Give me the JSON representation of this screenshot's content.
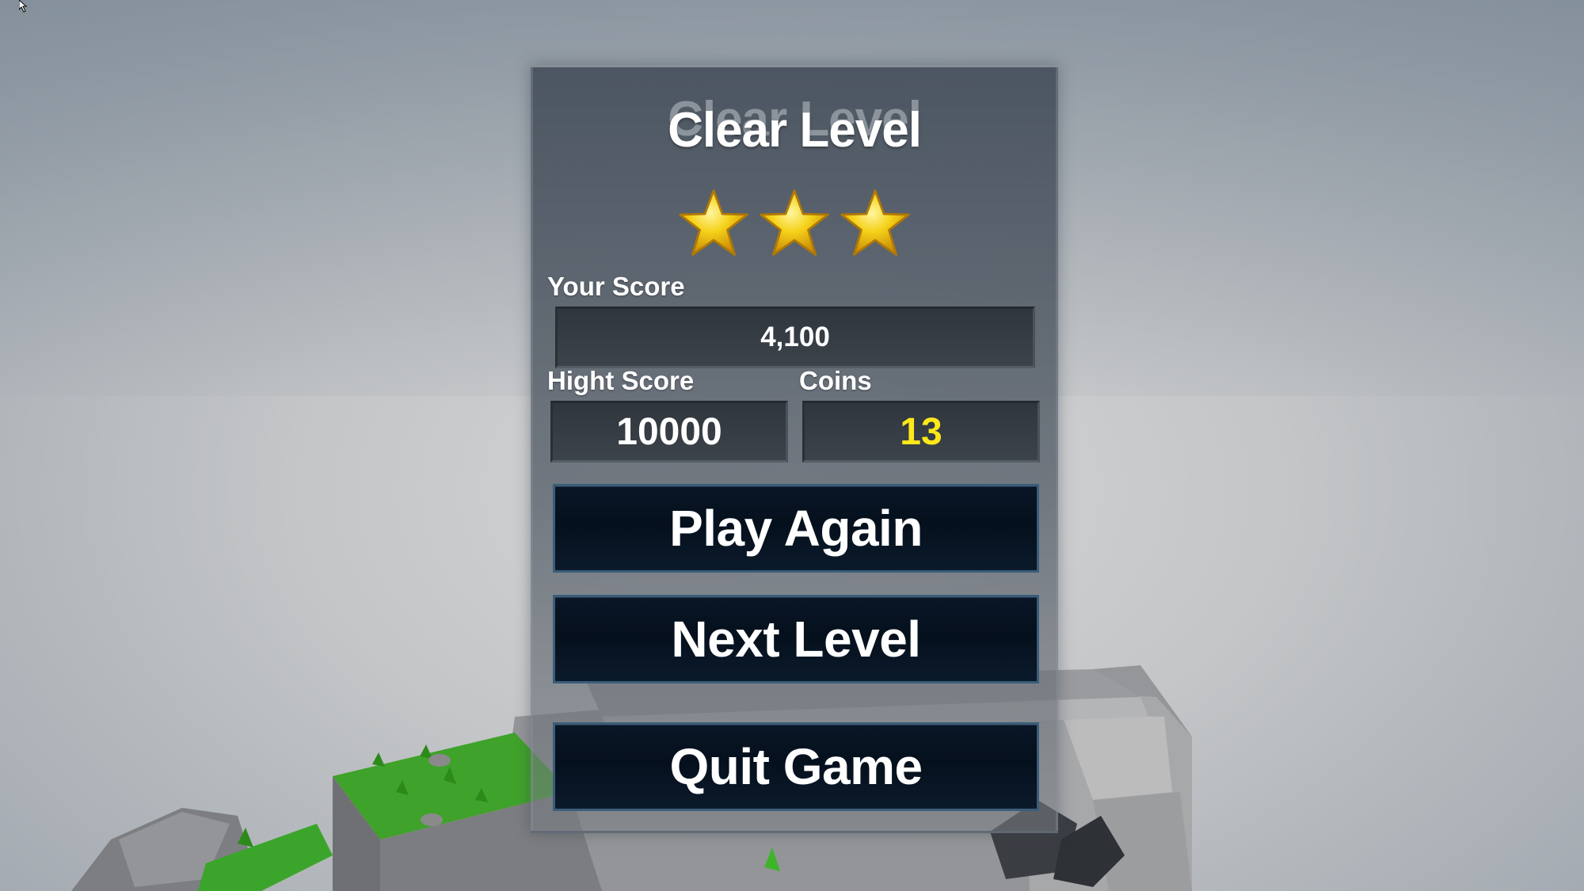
{
  "dialog": {
    "title": "Clear Level",
    "stars_earned": 3,
    "stars_total": 3,
    "star_color": "#f5d21a",
    "your_score_label": "Your Score",
    "your_score_value": "4,100",
    "high_score_label": "Hight Score",
    "high_score_value": "10000",
    "coins_label": "Coins",
    "coins_value": "13",
    "coins_color": "#ffe81a"
  },
  "buttons": {
    "play_again": "Play Again",
    "next_level": "Next Level",
    "quit_game": "Quit Game"
  }
}
